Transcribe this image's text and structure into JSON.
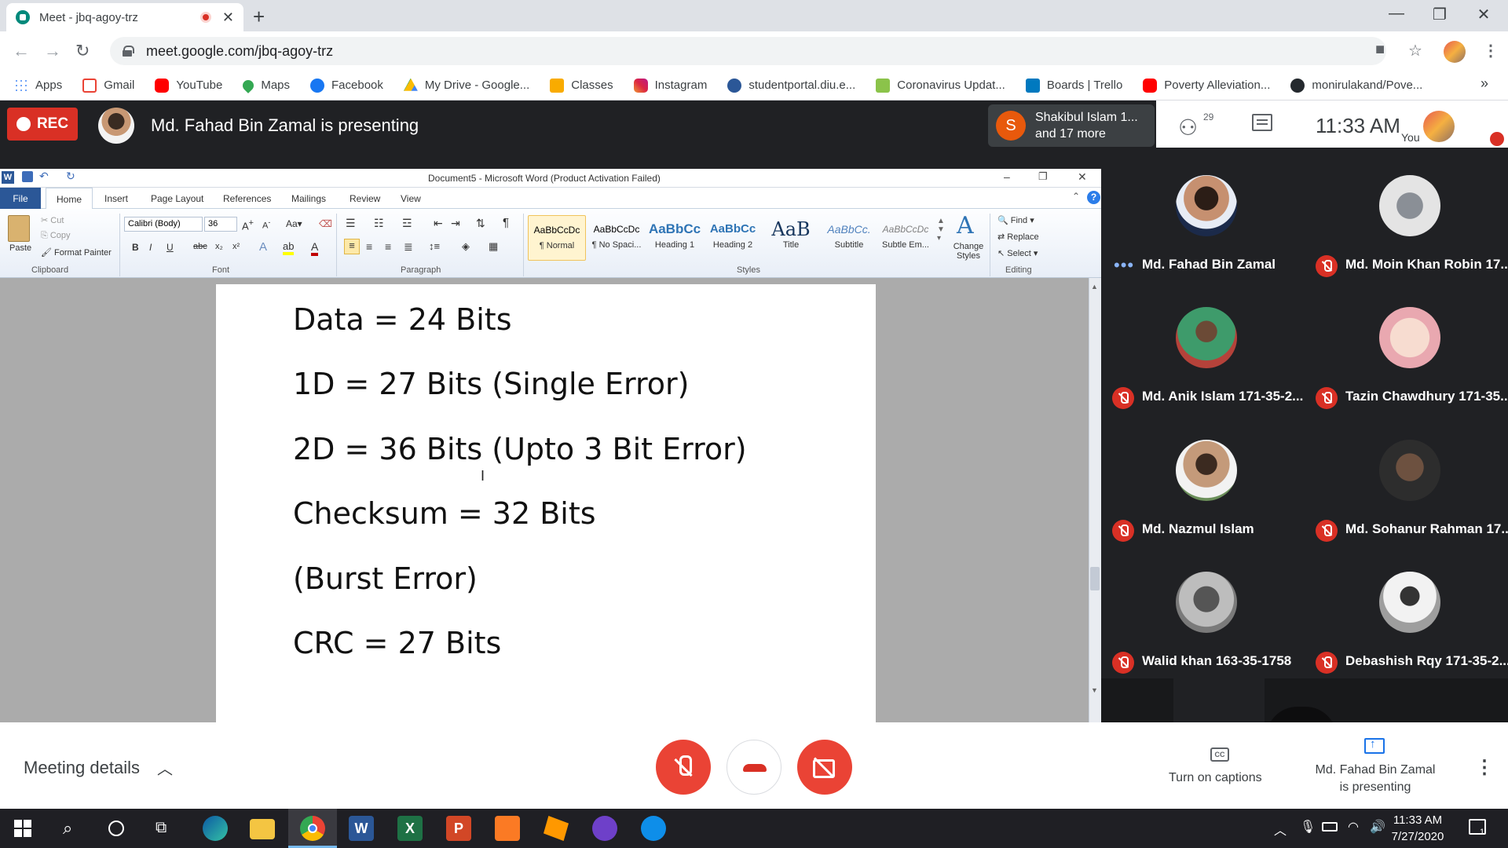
{
  "browser": {
    "tab_title": "Meet - jbq-agoy-trz",
    "new_tab": "+",
    "url": "meet.google.com/jbq-agoy-trz",
    "more_bookmarks": "»",
    "bookmarks": [
      {
        "label": "Apps",
        "color": "#4285f4"
      },
      {
        "label": "Gmail",
        "color": "#ea4335"
      },
      {
        "label": "YouTube",
        "color": "#ff0000"
      },
      {
        "label": "Maps",
        "color": "#34a853"
      },
      {
        "label": "Facebook",
        "color": "#1877f2"
      },
      {
        "label": "My Drive - Google...",
        "color": "#fbbc04"
      },
      {
        "label": "Classes",
        "color": "#f9ab00"
      },
      {
        "label": "Instagram",
        "color": "#c13584"
      },
      {
        "label": "studentportal.diu.e...",
        "color": "#2b5797"
      },
      {
        "label": "Coronavirus Updat...",
        "color": "#8bc34a"
      },
      {
        "label": "Boards | Trello",
        "color": "#0079bf"
      },
      {
        "label": "Poverty Alleviation...",
        "color": "#ff0000"
      },
      {
        "label": "monirulakand/Pove...",
        "color": "#24292e"
      }
    ]
  },
  "meet": {
    "rec_label": "REC",
    "presenting_text": "Md. Fahad Bin Zamal is presenting",
    "toast_initial": "S",
    "toast_line1": "Shakibul Islam 1...",
    "toast_line2": "and 17 more",
    "people_count": "29",
    "time": "11:33  AM",
    "you_label": "You",
    "meeting_details": "Meeting details",
    "captions_label": "Turn on captions",
    "cc_text": "CC",
    "presenting_line1": "Md. Fahad Bin Zamal",
    "presenting_line2": "is presenting",
    "participants": [
      {
        "name": "Md. Fahad Bin Zamal",
        "muted": false,
        "bg": "#1b2a4a"
      },
      {
        "name": "Md. Moin Khan Robin 17...",
        "muted": true,
        "bg": "#d9d9d9"
      },
      {
        "name": "Md. Anik Islam 171-35-2...",
        "muted": true,
        "bg": "#4a8b5c"
      },
      {
        "name": "Tazin Chawdhury 171-35...",
        "muted": true,
        "bg": "#f3d9c8"
      },
      {
        "name": "Md. Nazmul Islam",
        "muted": true,
        "bg": "#6b8f5a"
      },
      {
        "name": "Md. Sohanur Rahman 17...",
        "muted": true,
        "bg": "#3b3b3b"
      },
      {
        "name": "Walid khan 163-35-1758",
        "muted": true,
        "bg": "#8c8c8c"
      },
      {
        "name": "Debashish Rqy 171-35-2...",
        "muted": true,
        "bg": "#b0b0b0"
      }
    ]
  },
  "word": {
    "title": "Document5  -  Microsoft Word (Product Activation Failed)",
    "tabs": [
      "File",
      "Home",
      "Insert",
      "Page Layout",
      "References",
      "Mailings",
      "Review",
      "View"
    ],
    "clipboard": {
      "paste": "Paste",
      "cut": "Cut",
      "copy": "Copy",
      "format_painter": "Format Painter",
      "label": "Clipboard"
    },
    "font": {
      "name": "Calibri (Body)",
      "size": "36",
      "label": "Font"
    },
    "paragraph_label": "Paragraph",
    "styles": [
      {
        "sample": "AaBbCcDc",
        "name": "¶ Normal"
      },
      {
        "sample": "AaBbCcDc",
        "name": "¶ No Spaci..."
      },
      {
        "sample": "AaBbCc",
        "name": "Heading 1"
      },
      {
        "sample": "AaBbCc",
        "name": "Heading 2"
      },
      {
        "sample": "AaB",
        "name": "Title"
      },
      {
        "sample": "AaBbCc.",
        "name": "Subtitle"
      },
      {
        "sample": "AaBbCcDc",
        "name": "Subtle Em..."
      }
    ],
    "change_styles": "Change Styles",
    "styles_label": "Styles",
    "editing": {
      "find": "Find",
      "replace": "Replace",
      "select": "Select",
      "label": "Editing"
    },
    "document_lines": [
      "Data = 24 Bits",
      "1D = 27 Bits (Single Error)",
      "2D = 36 Bits (Upto 3 Bit Error)",
      "Checksum = 32 Bits",
      "(Burst Error)",
      "CRC = 27 Bits"
    ]
  },
  "taskbar": {
    "time": "11:33 AM",
    "date": "7/27/2020",
    "notifications": "1"
  }
}
